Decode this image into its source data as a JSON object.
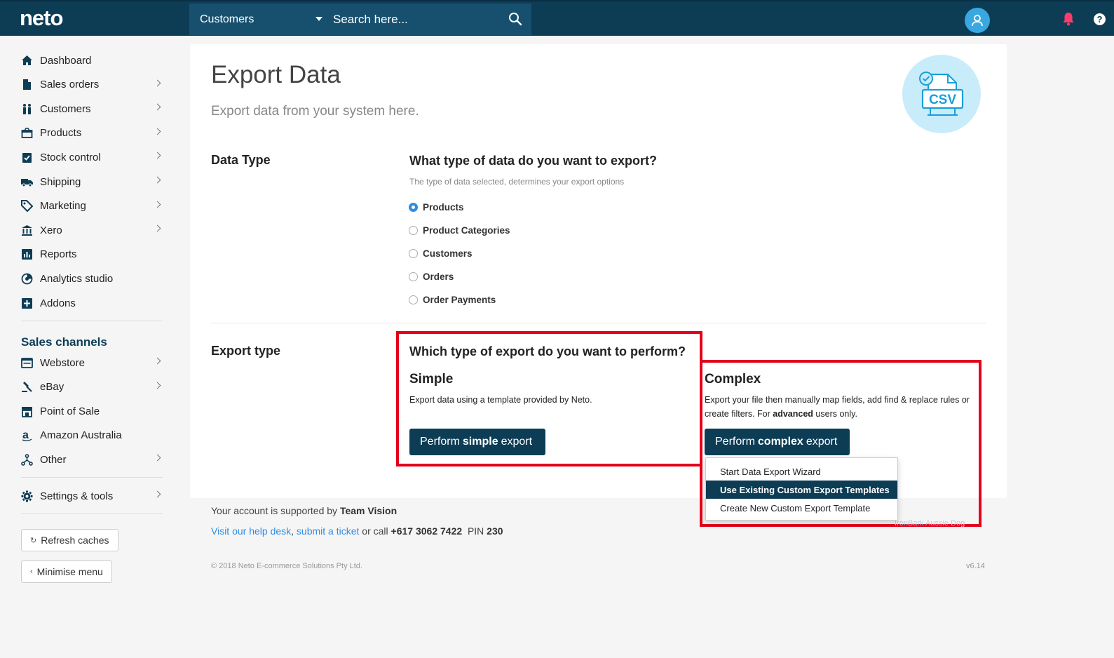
{
  "topbar": {
    "logo": "neto",
    "search_scope": "Customers",
    "search_placeholder": "Search here..."
  },
  "sidebar": {
    "items": [
      {
        "label": "Dashboard",
        "icon": "home-icon",
        "has_children": false
      },
      {
        "label": "Sales orders",
        "icon": "document-icon",
        "has_children": true
      },
      {
        "label": "Customers",
        "icon": "people-icon",
        "has_children": true
      },
      {
        "label": "Products",
        "icon": "box-icon",
        "has_children": true
      },
      {
        "label": "Stock control",
        "icon": "clipboard-check-icon",
        "has_children": true
      },
      {
        "label": "Shipping",
        "icon": "truck-icon",
        "has_children": true
      },
      {
        "label": "Marketing",
        "icon": "tag-icon",
        "has_children": true
      },
      {
        "label": "Xero",
        "icon": "bank-icon",
        "has_children": true
      },
      {
        "label": "Reports",
        "icon": "bar-chart-icon",
        "has_children": false
      },
      {
        "label": "Analytics studio",
        "icon": "analytics-icon",
        "has_children": false
      },
      {
        "label": "Addons",
        "icon": "plus-square-icon",
        "has_children": false
      }
    ],
    "channels_heading": "Sales channels",
    "channels": [
      {
        "label": "Webstore",
        "icon": "browser-icon",
        "has_children": true
      },
      {
        "label": "eBay",
        "icon": "gavel-icon",
        "has_children": true
      },
      {
        "label": "Point of Sale",
        "icon": "store-icon",
        "has_children": false
      },
      {
        "label": "Amazon Australia",
        "icon": "amazon-icon",
        "has_children": false
      },
      {
        "label": "Other",
        "icon": "network-icon",
        "has_children": true
      }
    ],
    "settings": {
      "label": "Settings & tools",
      "icon": "gear-icon",
      "has_children": true
    },
    "refresh_label": "Refresh caches",
    "minimise_label": "Minimise menu"
  },
  "main": {
    "title": "Export Data",
    "subtitle": "Export data from your system here.",
    "csv_label": "CSV",
    "data_type": {
      "label": "Data Type",
      "question": "What type of data do you want to export?",
      "hint": "The type of data selected, determines your export options",
      "options": [
        {
          "label": "Products",
          "checked": true
        },
        {
          "label": "Product Categories",
          "checked": false
        },
        {
          "label": "Customers",
          "checked": false
        },
        {
          "label": "Orders",
          "checked": false
        },
        {
          "label": "Order Payments",
          "checked": false
        }
      ]
    },
    "export_type": {
      "label": "Export type",
      "question": "Which type of export do you want to perform?",
      "simple": {
        "heading": "Simple",
        "desc": "Export data using a template provided by Neto.",
        "btn_pre": "Perform",
        "btn_bold": "simple",
        "btn_post": "export"
      },
      "complex": {
        "heading": "Complex",
        "desc_line1": "Export your file then manually map fields, add find & replace rules or",
        "desc_line2_pre": "create filters. For",
        "desc_line2_bold": "advanced",
        "desc_line2_post": "users only.",
        "btn_pre": "Perform",
        "btn_bold": "complex",
        "btn_post": "export",
        "menu": [
          "Start Data Export Wizard",
          "Use Existing Custom Export Templates",
          "Create New Custom Export Template"
        ],
        "menu_active_index": 1
      }
    }
  },
  "footer": {
    "supported_pre": "Your account is supported by",
    "supported_name": "Team Vision",
    "help_link": "Visit our help desk",
    "comma": ",",
    "ticket_link": "submit a ticket",
    "call_text": "or call",
    "phone": "+617 3062 7422",
    "pin_label": "PIN",
    "pin": "230",
    "copyright": "© 2018 Neto E-commerce Solutions Pty Ltd.",
    "version": "v6.14",
    "ghost_text": "IronBark Aussie Dog"
  },
  "colors": {
    "topbar": "#0d3c55",
    "accent": "#2d8ce6",
    "highlight": "#e3001b",
    "avatar": "#3aa8e0",
    "bell": "#ff3b6b"
  }
}
